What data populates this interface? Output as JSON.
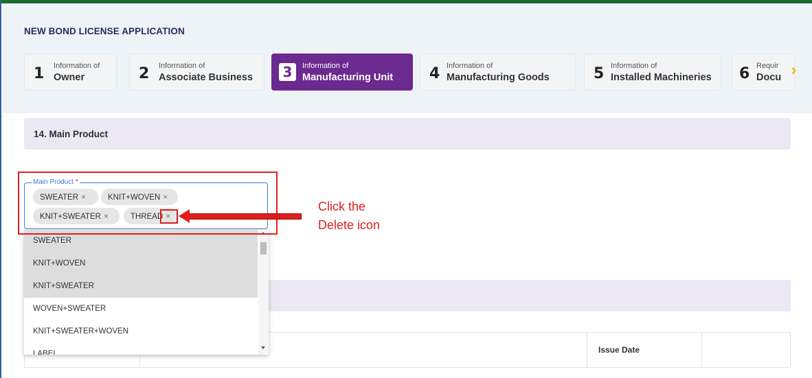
{
  "app": {
    "title": "NEW BOND LICENSE APPLICATION"
  },
  "steps": [
    {
      "num": "1",
      "small": "Information of",
      "big": "Owner"
    },
    {
      "num": "2",
      "small": "Information of",
      "big": "Associate Business"
    },
    {
      "num": "3",
      "small": "Information of",
      "big": "Manufacturing Unit",
      "active": true
    },
    {
      "num": "4",
      "small": "Information of",
      "big": "Manufacturing Goods"
    },
    {
      "num": "5",
      "small": "Information of",
      "big": "Installed Machineries"
    },
    {
      "num": "6",
      "small": "Requir",
      "big": "Docu"
    }
  ],
  "section": {
    "title": "14. Main Product"
  },
  "field": {
    "label": "Main Product",
    "required_mark": "*",
    "chips": [
      "SWEATER",
      "KNIT+WOVEN",
      "KNIT+SWEATER",
      "THREAD"
    ],
    "chip_remove_glyph": "×"
  },
  "dropdown": {
    "options": [
      "SWEATER",
      "KNIT+WOVEN",
      "KNIT+SWEATER",
      "WOVEN+SWEATER",
      "KNIT+SWEATER+WOVEN",
      "LABEL"
    ],
    "selected": [
      "SWEATER",
      "KNIT+WOVEN",
      "KNIT+SWEATER"
    ]
  },
  "table": {
    "issue_date_header": "Issue Date"
  },
  "annotation": {
    "line1": "Click the",
    "line2": "Delete icon"
  },
  "colors": {
    "accent": "#6b2a8f",
    "annotation": "#e01e1e",
    "topbar": "#1d6b2e",
    "field_border": "#3b7bd9"
  },
  "icons": {
    "next_step": "chevron-right-icon",
    "remove_chip": "close-icon"
  }
}
